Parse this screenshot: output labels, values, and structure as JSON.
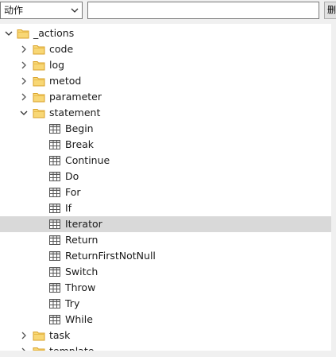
{
  "toolbar": {
    "type_select_value": "动作",
    "search_value": "",
    "clear_button_label": "删"
  },
  "tree": {
    "root": {
      "label": "_actions",
      "expanded": true,
      "icon": "folder-icon"
    },
    "children": [
      {
        "label": "code",
        "expanded": false,
        "icon": "folder-icon"
      },
      {
        "label": "log",
        "expanded": false,
        "icon": "folder-icon"
      },
      {
        "label": "metod",
        "expanded": false,
        "icon": "folder-icon"
      },
      {
        "label": "parameter",
        "expanded": false,
        "icon": "folder-icon"
      },
      {
        "label": "statement",
        "expanded": true,
        "icon": "folder-icon"
      },
      {
        "label": "task",
        "expanded": false,
        "icon": "folder-icon"
      },
      {
        "label": "template",
        "expanded": false,
        "icon": "folder-icon"
      }
    ],
    "statement_items": [
      {
        "label": "Begin",
        "icon": "table-icon"
      },
      {
        "label": "Break",
        "icon": "table-icon"
      },
      {
        "label": "Continue",
        "icon": "table-icon"
      },
      {
        "label": "Do",
        "icon": "table-icon"
      },
      {
        "label": "For",
        "icon": "table-icon"
      },
      {
        "label": "If",
        "icon": "table-icon"
      },
      {
        "label": "Iterator",
        "icon": "table-icon",
        "selected": true
      },
      {
        "label": "Return",
        "icon": "table-icon"
      },
      {
        "label": "ReturnFirstNotNull",
        "icon": "table-icon"
      },
      {
        "label": "Switch",
        "icon": "table-icon"
      },
      {
        "label": "Throw",
        "icon": "table-icon"
      },
      {
        "label": "Try",
        "icon": "table-icon"
      },
      {
        "label": "While",
        "icon": "table-icon"
      }
    ]
  },
  "colors": {
    "selection": "#d9d9d9",
    "folder": "#f8d775",
    "folder_edge": "#d9a22a",
    "table_icon": "#555555"
  }
}
